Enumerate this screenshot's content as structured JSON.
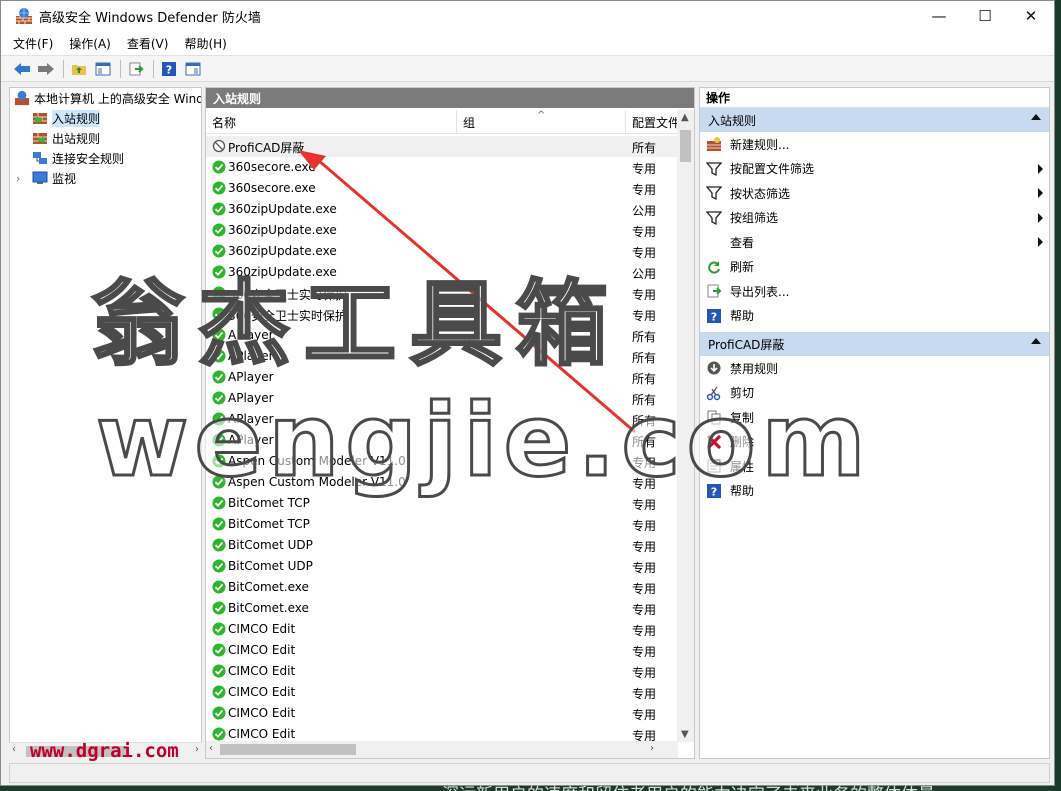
{
  "window": {
    "title": "高级安全 Windows Defender 防火墙",
    "controls": {
      "minimize": "—",
      "maximize": "☐",
      "close": "✕"
    }
  },
  "menu": [
    "文件(F)",
    "操作(A)",
    "查看(V)",
    "帮助(H)"
  ],
  "tree": {
    "root": "本地计算机 上的高级安全 Wind",
    "items": [
      "入站规则",
      "出站规则",
      "连接安全规则",
      "监视"
    ]
  },
  "center": {
    "header": "入站规则",
    "columns": {
      "name": "名称",
      "group": "组",
      "profile": "配置文件"
    },
    "rows": [
      {
        "name": "ProfiCAD屏蔽",
        "profile": "所有",
        "status": "blocked"
      },
      {
        "name": "360secore.exe",
        "profile": "专用",
        "status": "allowed"
      },
      {
        "name": "360secore.exe",
        "profile": "专用",
        "status": "allowed"
      },
      {
        "name": "360zipUpdate.exe",
        "profile": "公用",
        "status": "allowed"
      },
      {
        "name": "360zipUpdate.exe",
        "profile": "专用",
        "status": "allowed"
      },
      {
        "name": "360zipUpdate.exe",
        "profile": "专用",
        "status": "allowed"
      },
      {
        "name": "360zipUpdate.exe",
        "profile": "公用",
        "status": "allowed"
      },
      {
        "name": "360安全卫士实时保护",
        "profile": "专用",
        "status": "allowed"
      },
      {
        "name": "360安全卫士实时保护",
        "profile": "专用",
        "status": "allowed"
      },
      {
        "name": "APlayer",
        "profile": "所有",
        "status": "allowed"
      },
      {
        "name": "APlayer",
        "profile": "所有",
        "status": "allowed"
      },
      {
        "name": "APlayer",
        "profile": "所有",
        "status": "allowed"
      },
      {
        "name": "APlayer",
        "profile": "所有",
        "status": "allowed"
      },
      {
        "name": "APlayer",
        "profile": "所有",
        "status": "allowed"
      },
      {
        "name": "APlayer",
        "profile": "所有",
        "status": "allowed"
      },
      {
        "name": "Aspen Custom Modeler V11.0",
        "profile": "专用",
        "status": "allowed"
      },
      {
        "name": "Aspen Custom Modeler V11.0",
        "profile": "专用",
        "status": "allowed"
      },
      {
        "name": "BitComet TCP",
        "profile": "专用",
        "status": "allowed"
      },
      {
        "name": "BitComet TCP",
        "profile": "专用",
        "status": "allowed"
      },
      {
        "name": "BitComet UDP",
        "profile": "专用",
        "status": "allowed"
      },
      {
        "name": "BitComet UDP",
        "profile": "专用",
        "status": "allowed"
      },
      {
        "name": "BitComet.exe",
        "profile": "专用",
        "status": "allowed"
      },
      {
        "name": "BitComet.exe",
        "profile": "专用",
        "status": "allowed"
      },
      {
        "name": "CIMCO Edit",
        "profile": "专用",
        "status": "allowed"
      },
      {
        "name": "CIMCO Edit",
        "profile": "专用",
        "status": "allowed"
      },
      {
        "name": "CIMCO Edit",
        "profile": "专用",
        "status": "allowed"
      },
      {
        "name": "CIMCO Edit",
        "profile": "专用",
        "status": "allowed"
      },
      {
        "name": "CIMCO Edit",
        "profile": "专用",
        "status": "allowed"
      },
      {
        "name": "CIMCO Edit",
        "profile": "专用",
        "status": "allowed"
      }
    ]
  },
  "actions": {
    "header": "操作",
    "section1": {
      "title": "入站规则",
      "items": [
        {
          "label": "新建规则...",
          "icon": "new-rule-icon",
          "submenu": false
        },
        {
          "label": "按配置文件筛选",
          "icon": "filter-icon",
          "submenu": true
        },
        {
          "label": "按状态筛选",
          "icon": "filter-icon",
          "submenu": true
        },
        {
          "label": "按组筛选",
          "icon": "filter-icon",
          "submenu": true
        },
        {
          "label": "查看",
          "icon": "",
          "submenu": true
        },
        {
          "label": "刷新",
          "icon": "refresh-icon",
          "submenu": false
        },
        {
          "label": "导出列表...",
          "icon": "export-icon",
          "submenu": false
        },
        {
          "label": "帮助",
          "icon": "help-icon",
          "submenu": false
        }
      ]
    },
    "section2": {
      "title": "ProfiCAD屏蔽",
      "items": [
        {
          "label": "禁用规则",
          "icon": "disable-icon",
          "submenu": false
        },
        {
          "label": "剪切",
          "icon": "cut-icon",
          "submenu": false
        },
        {
          "label": "复制",
          "icon": "copy-icon",
          "submenu": false
        },
        {
          "label": "删除",
          "icon": "delete-icon",
          "submenu": false
        },
        {
          "label": "属性",
          "icon": "properties-icon",
          "submenu": false
        },
        {
          "label": "帮助",
          "icon": "help-icon",
          "submenu": false
        }
      ]
    }
  },
  "overlay": {
    "watermark_cn": "翁杰工具箱",
    "watermark_en": "wengjie.com",
    "watermark_url": "www.dgrai.com",
    "bottom_text": "深远新用户的速度和留住老用户的能力决定了未来业务的整体体量"
  },
  "colors": {
    "allowed": "#2db52d",
    "blocked": "#555555",
    "arrow": "#e8322a",
    "section": "#c7daf0"
  }
}
